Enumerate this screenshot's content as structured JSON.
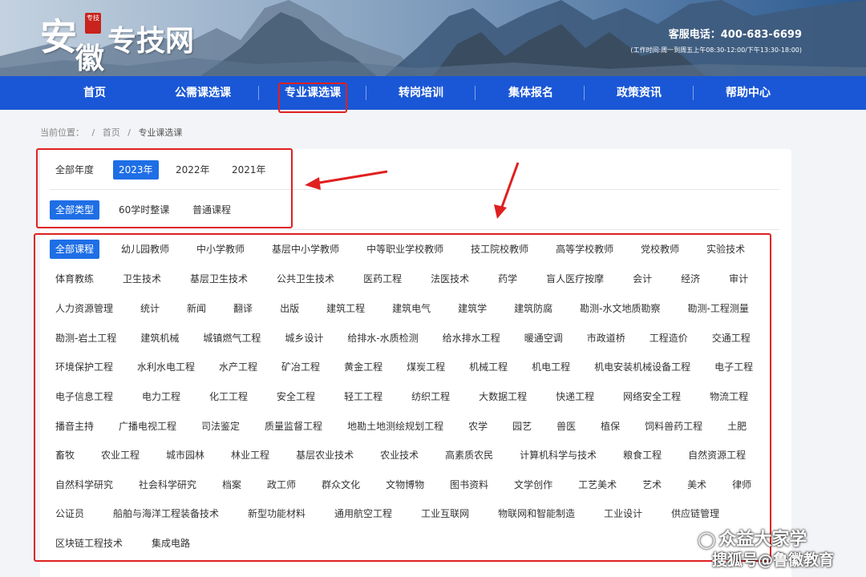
{
  "header": {
    "logo_char1": "安",
    "logo_char2": "徽",
    "logo_rest": "专技网",
    "logo_seal": "专技",
    "hotline": "客服电话：400-683-6699",
    "hours": "(工作时间:周一到周五上午08:30-12:00/下午13:30-18:00)"
  },
  "nav": {
    "items": [
      {
        "label": "首页"
      },
      {
        "label": "公需课选课"
      },
      {
        "label": "专业课选课"
      },
      {
        "label": "转岗培训"
      },
      {
        "label": "集体报名"
      },
      {
        "label": "政策资讯"
      },
      {
        "label": "帮助中心"
      }
    ],
    "active": "专业课选课"
  },
  "breadcrumb": {
    "prefix": "当前位置：",
    "sep": "/",
    "home": "首页",
    "current": "专业课选课"
  },
  "filters": {
    "years": [
      {
        "label": "全部年度",
        "active": false
      },
      {
        "label": "2023年",
        "active": true
      },
      {
        "label": "2022年",
        "active": false
      },
      {
        "label": "2021年",
        "active": false
      }
    ],
    "types": [
      {
        "label": "全部类型",
        "active": true
      },
      {
        "label": "60学时整课",
        "active": false
      },
      {
        "label": "普通课程",
        "active": false
      }
    ]
  },
  "courses": {
    "rows": [
      [
        "全部课程",
        "幼儿园教师",
        "中小学教师",
        "基层中小学教师",
        "中等职业学校教师",
        "技工院校教师",
        "高等学校教师",
        "党校教师",
        "实验技术"
      ],
      [
        "体育教练",
        "卫生技术",
        "基层卫生技术",
        "公共卫生技术",
        "医药工程",
        "法医技术",
        "药学",
        "盲人医疗按摩",
        "会计",
        "经济",
        "审计"
      ],
      [
        "人力资源管理",
        "统计",
        "新闻",
        "翻译",
        "出版",
        "建筑工程",
        "建筑电气",
        "建筑学",
        "建筑防腐",
        "勘测-水文地质勘察",
        "勘测-工程测量"
      ],
      [
        "勘测-岩土工程",
        "建筑机械",
        "城镇燃气工程",
        "城乡设计",
        "给排水-水质检测",
        "给水排水工程",
        "暖通空调",
        "市政道桥",
        "工程造价",
        "交通工程"
      ],
      [
        "环境保护工程",
        "水利水电工程",
        "水产工程",
        "矿冶工程",
        "黄金工程",
        "煤炭工程",
        "机械工程",
        "机电工程",
        "机电安装机械设备工程",
        "电子工程"
      ],
      [
        "电子信息工程",
        "电力工程",
        "化工工程",
        "安全工程",
        "轻工工程",
        "纺织工程",
        "大数据工程",
        "快递工程",
        "网络安全工程",
        "物流工程"
      ],
      [
        "播音主持",
        "广播电视工程",
        "司法鉴定",
        "质量监督工程",
        "地勘土地测绘规划工程",
        "农学",
        "园艺",
        "兽医",
        "植保",
        "饲料兽药工程",
        "土肥"
      ],
      [
        "畜牧",
        "农业工程",
        "城市园林",
        "林业工程",
        "基层农业技术",
        "农业技术",
        "高素质农民",
        "计算机科学与技术",
        "粮食工程",
        "自然资源工程"
      ],
      [
        "自然科学研究",
        "社会科学研究",
        "档案",
        "政工师",
        "群众文化",
        "文物博物",
        "图书资料",
        "文学创作",
        "工艺美术",
        "艺术",
        "美术",
        "律师"
      ],
      [
        "公证员",
        "船舶与海洋工程装备技术",
        "新型功能材料",
        "通用航空工程",
        "工业互联网",
        "物联网和智能制造",
        "工业设计",
        "供应链管理"
      ],
      [
        "区块链工程技术",
        "集成电路"
      ]
    ],
    "active": "全部课程"
  },
  "watermark": {
    "line1": "众益大家学",
    "line2": "搜狐号@鲁徽教育"
  }
}
